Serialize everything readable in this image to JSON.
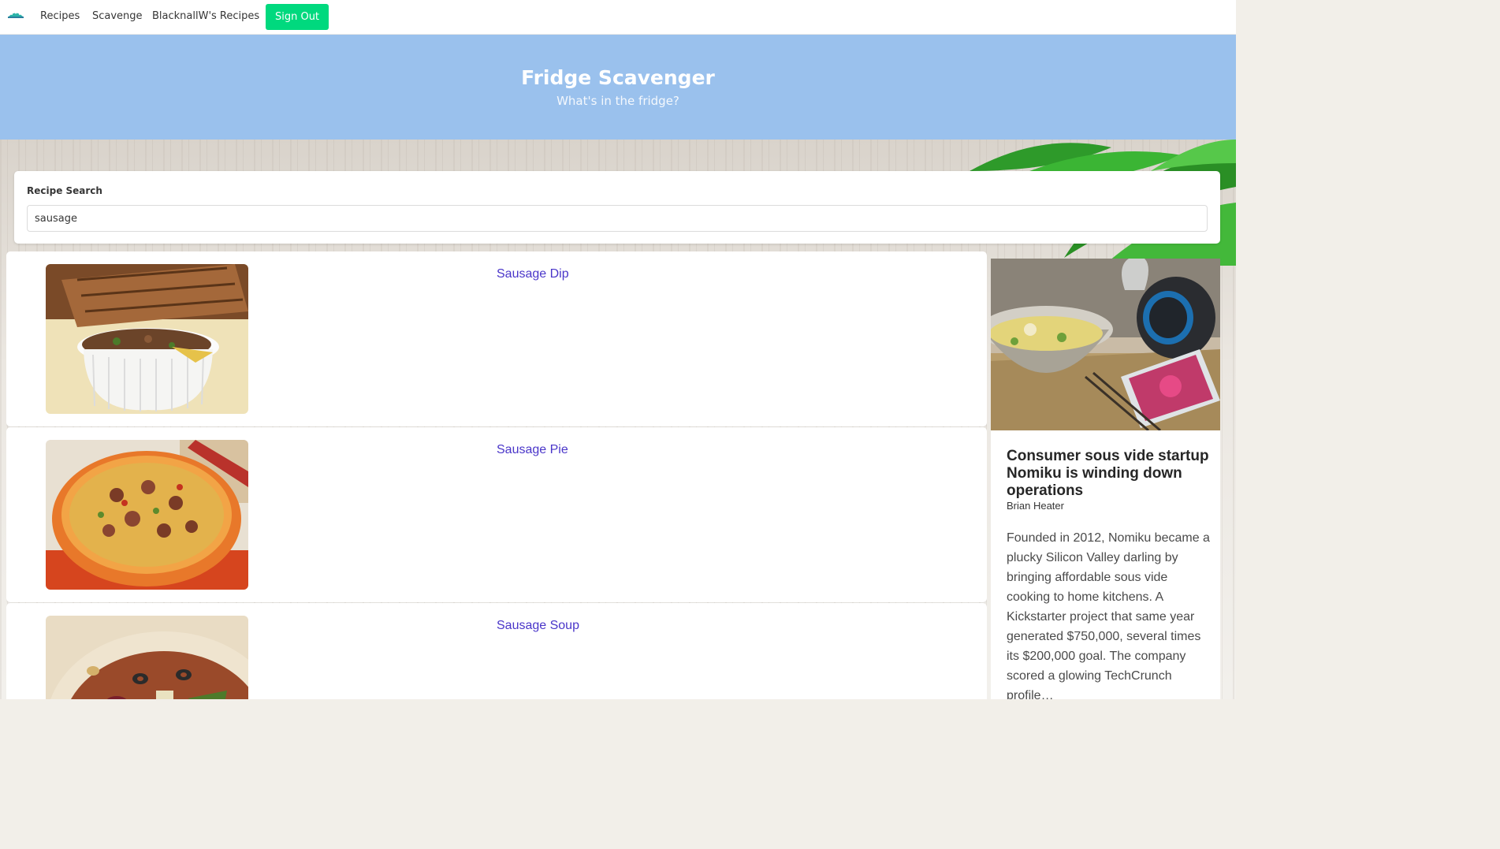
{
  "nav": {
    "links": [
      "Recipes",
      "Scavenge",
      "BlacknallW's Recipes"
    ],
    "signout_label": "Sign Out",
    "signout_color": "#00d97e"
  },
  "hero": {
    "title": "Fridge Scavenger",
    "subtitle": "What's in the fridge?",
    "color": "#9ac1ed"
  },
  "search": {
    "label": "Recipe Search",
    "value": "sausage"
  },
  "recipes": [
    {
      "title": "Sausage Dip",
      "image": "sausage-dip-photo"
    },
    {
      "title": "Sausage Pie",
      "image": "sausage-pie-photo"
    },
    {
      "title": "Sausage Soup",
      "image": "sausage-soup-photo"
    }
  ],
  "news": {
    "title": "Consumer sous vide startup Nomiku is winding down operations",
    "author": "Brian Heater",
    "body": "Founded in 2012, Nomiku became a plucky Silicon Valley darling by bringing affordable sous vide cooking to home kitchens. A Kickstarter project that same year generated $750,000, several times its $200,000 goal. The company scored a glowing TechCrunch profile…",
    "image": "sous-vide-device-photo"
  },
  "link_color": "#4a36c9"
}
